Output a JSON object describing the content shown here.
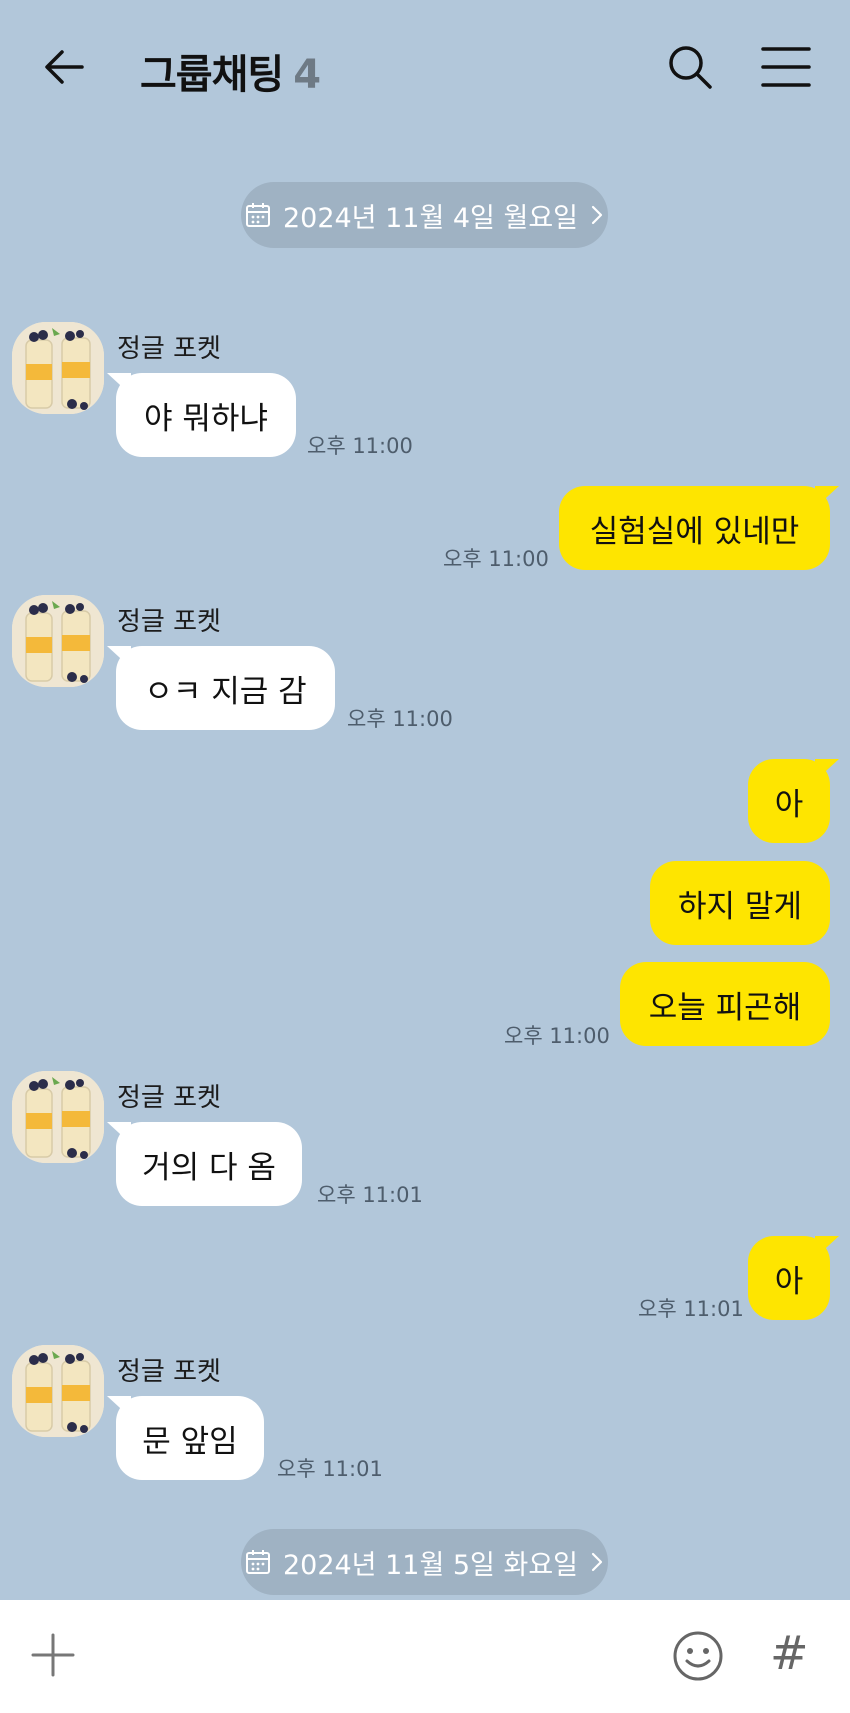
{
  "header": {
    "title": "그룹채팅",
    "member_count": "4"
  },
  "dates": [
    "2024년 11월 4일 월요일",
    "2024년 11월 5일 화요일"
  ],
  "messages": [
    {
      "sender": "정글 포켓",
      "text": "야 뭐하냐",
      "time": "오후 11:00"
    },
    {
      "text": "실험실에 있네만",
      "time": "오후 11:00"
    },
    {
      "sender": "정글 포켓",
      "text": "ㅇㅋ 지금 감",
      "time": "오후 11:00"
    },
    {
      "text": "아"
    },
    {
      "text": "하지 말게"
    },
    {
      "text": "오늘 피곤해",
      "time": "오후 11:00"
    },
    {
      "sender": "정글 포켓",
      "text": "거의 다 옴",
      "time": "오후 11:01"
    },
    {
      "text": "아",
      "time": "오후 11:01"
    },
    {
      "sender": "정글 포켓",
      "text": "문 앞임",
      "time": "오후 11:01"
    }
  ],
  "composer": {
    "hash_label": "#"
  },
  "colors": {
    "background": "#b2c7da",
    "outgoing_bubble": "#fee500",
    "incoming_bubble": "#ffffff",
    "date_pill": "#9fb2c3"
  },
  "icons": [
    "back-arrow-icon",
    "search-icon",
    "menu-icon",
    "calendar-icon",
    "chevron-right-icon",
    "plus-icon",
    "emoji-icon"
  ]
}
